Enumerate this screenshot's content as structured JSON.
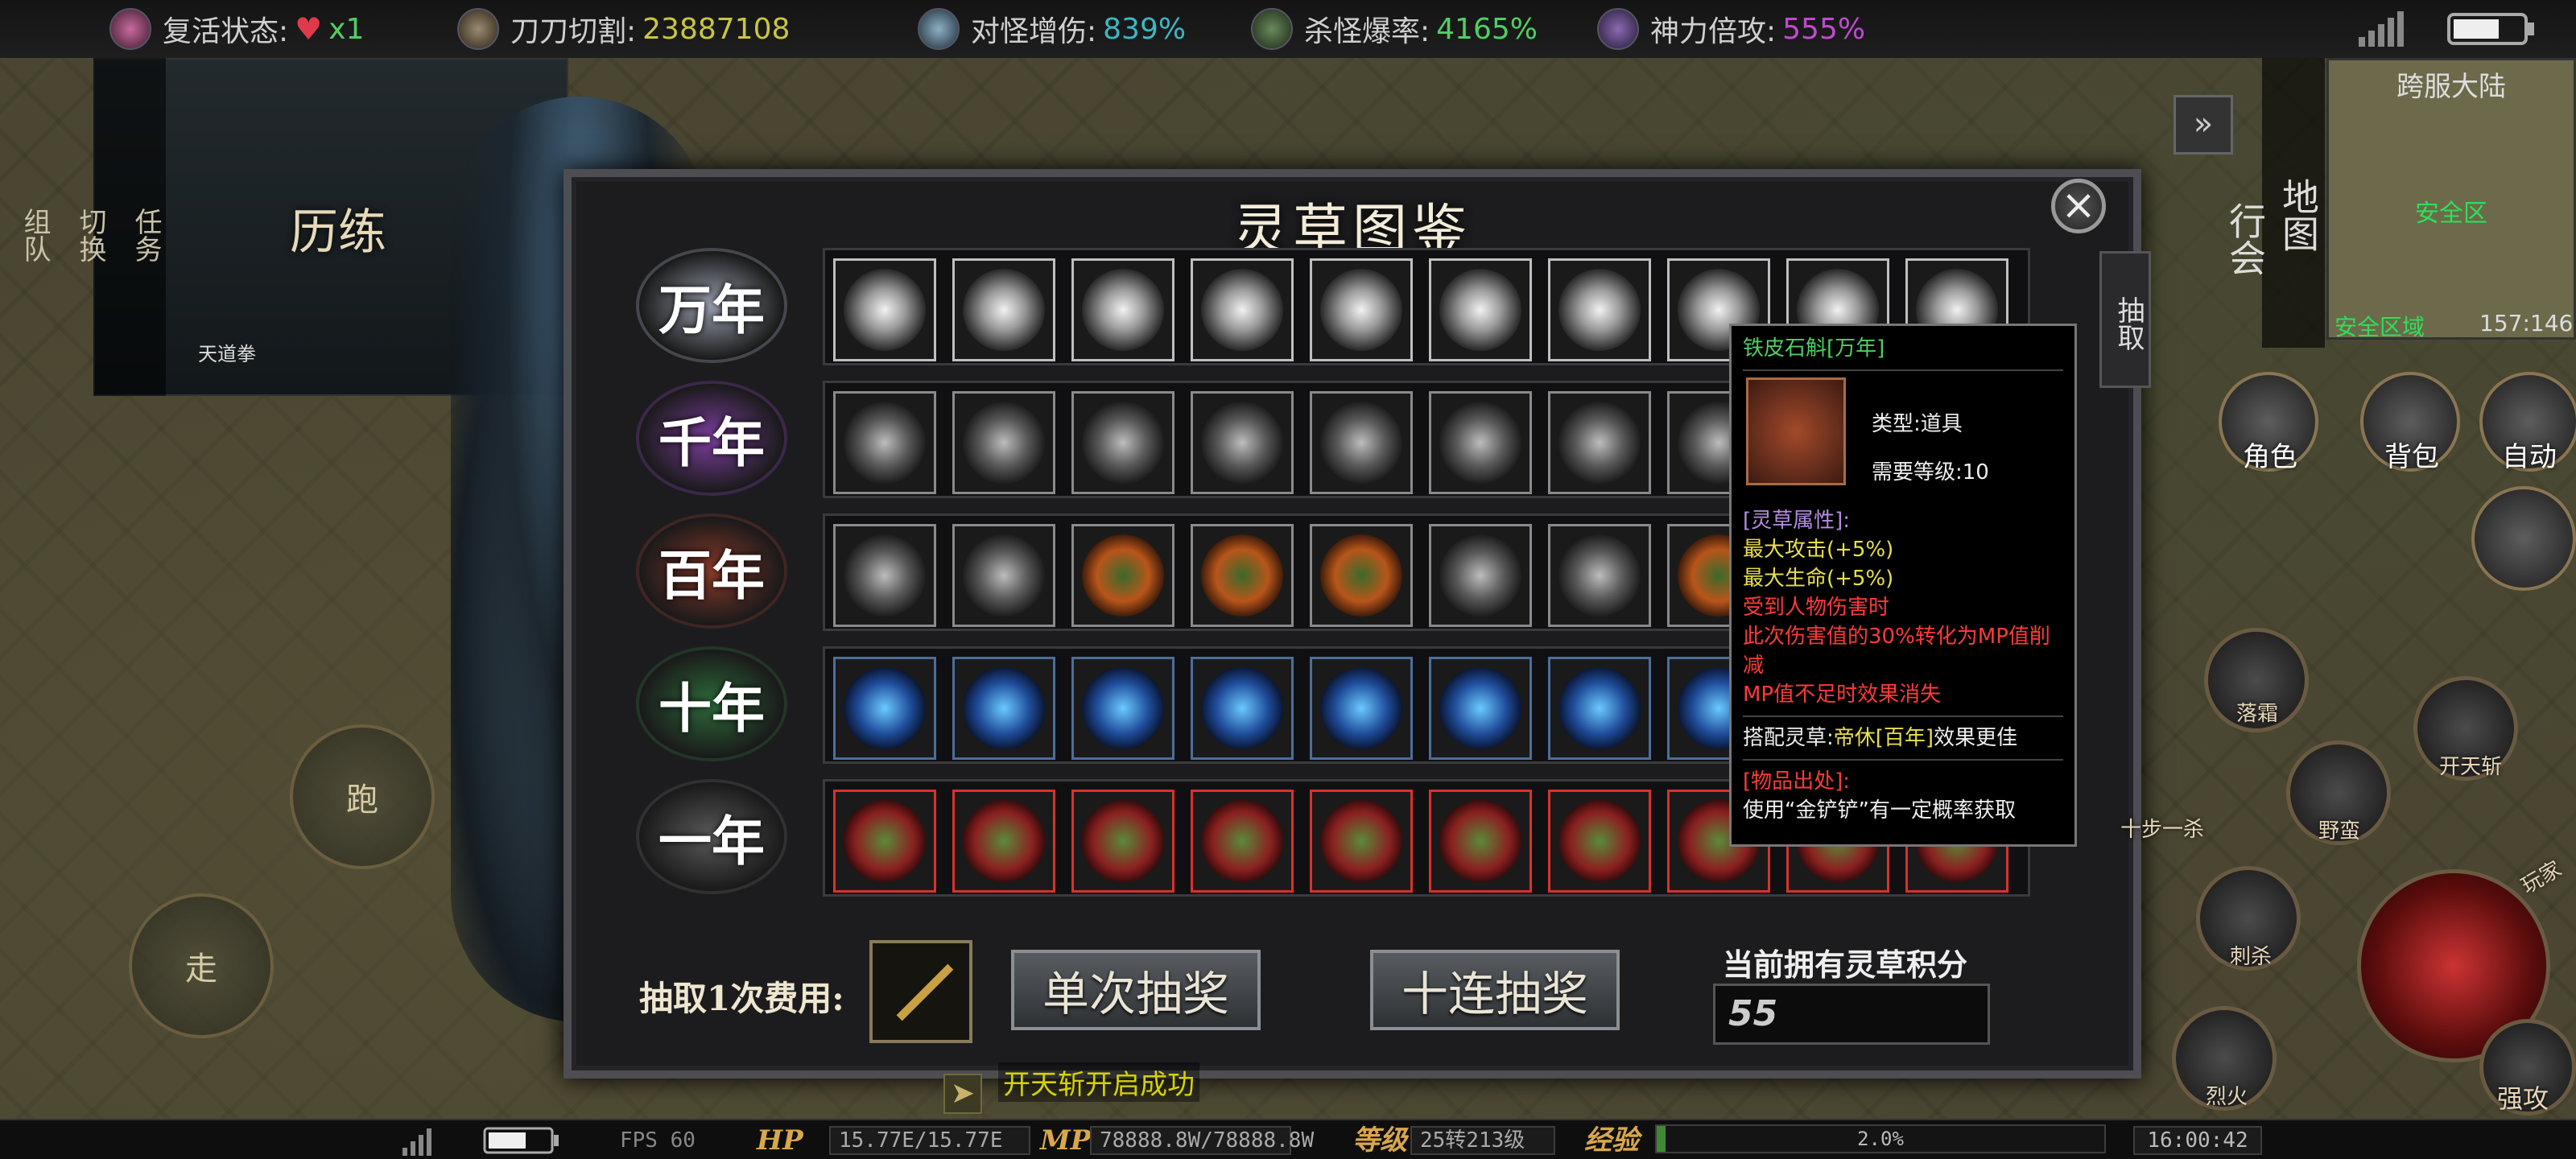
{
  "top_bar": {
    "revive_label": "复活状态:",
    "revive_value": "x1",
    "blade_label": "刀刀切割:",
    "blade_value": "23887108",
    "monster_dmg_label": "对怪增伤:",
    "monster_dmg_value": "839%",
    "drop_rate_label": "杀怪爆率:",
    "drop_rate_value": "4165%",
    "god_power_label": "神力倍攻:",
    "god_power_value": "555%",
    "colors": {
      "revive": "#e03a4a",
      "blade": "#c9c640",
      "monster_dmg": "#3bb8c4",
      "drop_rate": "#4fcf63",
      "god_power": "#c04ad0"
    }
  },
  "left_panel": {
    "tabs": [
      "任务",
      "切换",
      "组队"
    ],
    "title": "历练",
    "skill_name": "天道拳"
  },
  "main_panel": {
    "title": "灵草图鉴",
    "close_icon": "close-icon",
    "side_tab": "抽取",
    "rows": [
      {
        "age": "万年",
        "style": "silver-glow",
        "ring": "#9aa0b0"
      },
      {
        "age": "千年",
        "style": "gray",
        "ring": "#7d3fa0"
      },
      {
        "age": "百年",
        "style": "orange",
        "ring": "#8a3a2a"
      },
      {
        "age": "十年",
        "style": "blue",
        "ring": "#2d6b3a"
      },
      {
        "age": "一年",
        "style": "red",
        "ring": "#5a5a5a"
      }
    ],
    "cost_label": "抽取1次费用:",
    "cost_item_icon": "pickaxe-icon",
    "single_draw_label": "单次抽奖",
    "ten_draw_label": "十连抽奖",
    "points_label": "当前拥有灵草积分",
    "points_value": "55"
  },
  "tooltip": {
    "name": "铁皮石斛[万年]",
    "type_line": "类型:道具",
    "level_line": "需要等级:10",
    "attr_header": "[灵草属性]:",
    "attr_1": "最大攻击(+5%)",
    "attr_2": "最大生命(+5%)",
    "attr_3": "受到人物伤害时",
    "attr_4": "此次伤害值的30%转化为MP值削减",
    "attr_5": "MP值不足时效果消失",
    "combo_prefix": "搭配灵草:",
    "combo_herb": "帝休[百年]",
    "combo_suffix": "效果更佳",
    "source_header": "[物品出处]:",
    "source_text": "使用“金铲铲”有一定概率获取"
  },
  "minimap": {
    "title": "跨服大陆",
    "safe_zone": "安全区域",
    "map_safe_label": "安全区",
    "coords": "157:146",
    "side_tabs": [
      "地图",
      "行会"
    ]
  },
  "right_buttons": {
    "character": "角色",
    "bag": "背包",
    "auto": "自动",
    "skills": [
      "落霜",
      "开天斩",
      "野蛮",
      "刺杀",
      "烈火",
      "强攻",
      "十步一杀"
    ],
    "play_label": "玩家"
  },
  "joysticks": {
    "run": "跑",
    "walk": "走"
  },
  "chat": {
    "message": "开天斩开启成功"
  },
  "bottom_bar": {
    "fps": "FPS 60",
    "hp_label": "HP",
    "hp_value": "15.77E/15.77E",
    "mp_label": "MP",
    "mp_value": "78888.8W/78888.8W",
    "level_label": "等级",
    "level_value": "25转213级",
    "exp_label": "经验",
    "exp_value": "2.0%",
    "exp_fraction": 0.02,
    "time": "16:00:42"
  }
}
